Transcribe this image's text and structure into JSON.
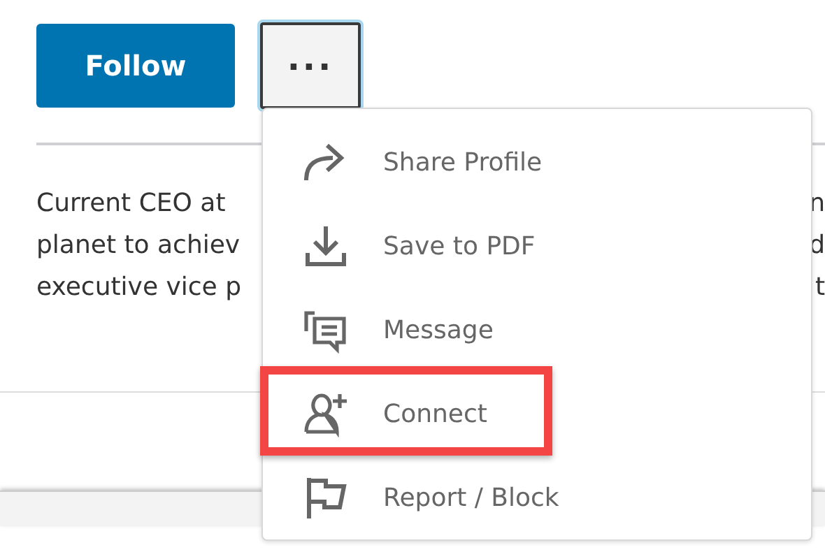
{
  "actions": {
    "follow": "Follow",
    "more": "..."
  },
  "summary_lines": [
    {
      "left": "Current CEO at",
      "right": "n"
    },
    {
      "left": "planet to achiev",
      "right": "d"
    },
    {
      "left": "executive vice p",
      "right": "t"
    }
  ],
  "menu": [
    {
      "kind": "share",
      "label": "Share Profile",
      "highlighted": false
    },
    {
      "kind": "save",
      "label": "Save to PDF",
      "highlighted": false
    },
    {
      "kind": "message",
      "label": "Message",
      "highlighted": false
    },
    {
      "kind": "connect",
      "label": "Connect",
      "highlighted": true
    },
    {
      "kind": "report",
      "label": "Report / Block",
      "highlighted": false
    }
  ]
}
